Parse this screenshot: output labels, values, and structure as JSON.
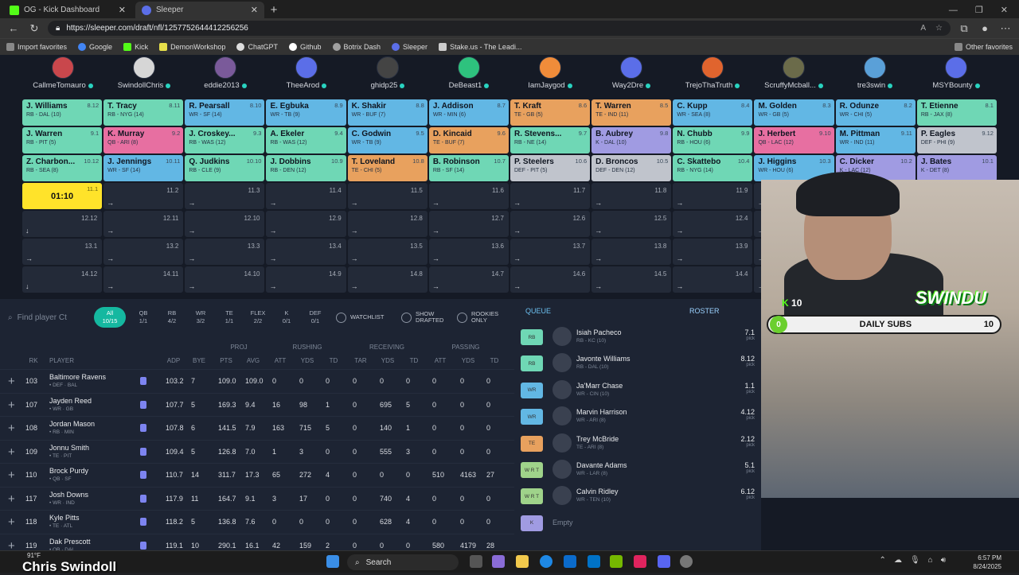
{
  "browser": {
    "tabs": [
      {
        "label": "OG - Kick Dashboard",
        "active": false
      },
      {
        "label": "Sleeper",
        "active": true
      }
    ],
    "url": "https://sleeper.com/draft/nfl/1257752644412256256",
    "bookmarks": [
      "Import favorites",
      "Google",
      "Kick",
      "DemonWorkshop",
      "ChatGPT",
      "Github",
      "Botrix Dash",
      "Sleeper",
      "Stake.us - The Leadi..."
    ],
    "other_favorites": "Other favorites"
  },
  "teams": [
    "CallmeTomauro",
    "SwindollChris",
    "eddie2013",
    "TheeArod",
    "ghidp25",
    "DeBeast1",
    "IamJaygod",
    "Way2Dre",
    "TrejoThaTruth",
    "ScruffyMcball...",
    "tre3swin",
    "MSYBounty"
  ],
  "board": {
    "rows": [
      [
        {
          "name": "J. Williams",
          "pos": "RB - DAL (10)",
          "no": "8.12",
          "cls": "rb"
        },
        {
          "name": "T. Tracy",
          "pos": "RB - NYG (14)",
          "no": "8.11",
          "cls": "rb"
        },
        {
          "name": "R. Pearsall",
          "pos": "WR - SF (14)",
          "no": "8.10",
          "cls": "wr"
        },
        {
          "name": "E. Egbuka",
          "pos": "WR - TB (9)",
          "no": "8.9",
          "cls": "wr"
        },
        {
          "name": "K. Shakir",
          "pos": "WR - BUF (7)",
          "no": "8.8",
          "cls": "wr"
        },
        {
          "name": "J. Addison",
          "pos": "WR - MIN (6)",
          "no": "8.7",
          "cls": "wr"
        },
        {
          "name": "T. Kraft",
          "pos": "TE - GB (5)",
          "no": "8.6",
          "cls": "te"
        },
        {
          "name": "T. Warren",
          "pos": "TE - IND (11)",
          "no": "8.5",
          "cls": "te"
        },
        {
          "name": "C. Kupp",
          "pos": "WR - SEA (8)",
          "no": "8.4",
          "cls": "wr"
        },
        {
          "name": "M. Golden",
          "pos": "WR - GB (5)",
          "no": "8.3",
          "cls": "wr"
        },
        {
          "name": "R. Odunze",
          "pos": "WR - CHI (5)",
          "no": "8.2",
          "cls": "wr"
        },
        {
          "name": "T. Etienne",
          "pos": "RB - JAX (8)",
          "no": "8.1",
          "cls": "rb"
        }
      ],
      [
        {
          "name": "J. Warren",
          "pos": "RB - PIT (5)",
          "no": "9.1",
          "cls": "rb"
        },
        {
          "name": "K. Murray",
          "pos": "QB - ARI (8)",
          "no": "9.2",
          "cls": "qb"
        },
        {
          "name": "J. Croskey...",
          "pos": "RB - WAS (12)",
          "no": "9.3",
          "cls": "rb"
        },
        {
          "name": "A. Ekeler",
          "pos": "RB - WAS (12)",
          "no": "9.4",
          "cls": "rb"
        },
        {
          "name": "C. Godwin",
          "pos": "WR - TB (9)",
          "no": "9.5",
          "cls": "wr"
        },
        {
          "name": "D. Kincaid",
          "pos": "TE - BUF (7)",
          "no": "9.6",
          "cls": "te"
        },
        {
          "name": "R. Stevens...",
          "pos": "RB - NE (14)",
          "no": "9.7",
          "cls": "rb"
        },
        {
          "name": "B. Aubrey",
          "pos": "K - DAL (10)",
          "no": "9.8",
          "cls": "k"
        },
        {
          "name": "N. Chubb",
          "pos": "RB - HOU (6)",
          "no": "9.9",
          "cls": "rb"
        },
        {
          "name": "J. Herbert",
          "pos": "QB - LAC (12)",
          "no": "9.10",
          "cls": "qb"
        },
        {
          "name": "M. Pittman",
          "pos": "WR - IND (11)",
          "no": "9.11",
          "cls": "wr"
        },
        {
          "name": "P. Eagles",
          "pos": "DEF - PHI (9)",
          "no": "9.12",
          "cls": "def"
        }
      ],
      [
        {
          "name": "Z. Charbon...",
          "pos": "RB - SEA (8)",
          "no": "10.12",
          "cls": "rb"
        },
        {
          "name": "J. Jennings",
          "pos": "WR - SF (14)",
          "no": "10.11",
          "cls": "wr"
        },
        {
          "name": "Q. Judkins",
          "pos": "RB - CLE (9)",
          "no": "10.10",
          "cls": "rb"
        },
        {
          "name": "J. Dobbins",
          "pos": "RB - DEN (12)",
          "no": "10.9",
          "cls": "rb"
        },
        {
          "name": "T. Loveland",
          "pos": "TE - CHI (5)",
          "no": "10.8",
          "cls": "te"
        },
        {
          "name": "B. Robinson",
          "pos": "RB - SF (14)",
          "no": "10.7",
          "cls": "rb"
        },
        {
          "name": "P. Steelers",
          "pos": "DEF - PIT (5)",
          "no": "10.6",
          "cls": "def"
        },
        {
          "name": "D. Broncos",
          "pos": "DEF - DEN (12)",
          "no": "10.5",
          "cls": "def"
        },
        {
          "name": "C. Skattebo",
          "pos": "RB - NYG (14)",
          "no": "10.4",
          "cls": "rb"
        },
        {
          "name": "J. Higgins",
          "pos": "WR - HOU (6)",
          "no": "10.3",
          "cls": "wr"
        },
        {
          "name": "C. Dicker",
          "pos": "K - LAC (12)",
          "no": "10.2",
          "cls": "k"
        },
        {
          "name": "J. Bates",
          "pos": "K - DET (8)",
          "no": "10.1",
          "cls": "k"
        }
      ]
    ],
    "clock": "01:10",
    "empty_rows": [
      [
        "11.1",
        "11.2",
        "11.3",
        "11.4",
        "11.5",
        "11.6",
        "11.7",
        "11.8",
        "11.9",
        "11.10",
        "11.11",
        "11.12"
      ],
      [
        "12.12",
        "12.11",
        "12.10",
        "12.9",
        "12.8",
        "12.7",
        "12.6",
        "12.5",
        "12.4",
        "12.3",
        "12.2",
        "12.1"
      ],
      [
        "13.1",
        "13.2",
        "13.3",
        "13.4",
        "13.5",
        "13.6",
        "13.7",
        "13.8",
        "13.9",
        "13.10",
        "13.11",
        "13.12"
      ],
      [
        "14.12",
        "14.11",
        "14.10",
        "14.9",
        "14.8",
        "14.7",
        "14.6",
        "14.5",
        "14.4",
        "14.3",
        "14.2",
        "14.1"
      ]
    ]
  },
  "filters": {
    "search_placeholder": "Find player Ct",
    "positions": [
      {
        "label": "All",
        "count": "10/15",
        "active": true
      },
      {
        "label": "QB",
        "count": "1/1"
      },
      {
        "label": "RB",
        "count": "4/2"
      },
      {
        "label": "WR",
        "count": "3/2"
      },
      {
        "label": "TE",
        "count": "1/1"
      },
      {
        "label": "FLEX",
        "count": "2/2"
      },
      {
        "label": "K",
        "count": "0/1"
      },
      {
        "label": "DEF",
        "count": "0/1"
      }
    ],
    "watchlist": "WATCHLIST",
    "show_drafted": "SHOW DRAFTED",
    "rookies_only": "ROOKIES ONLY"
  },
  "table": {
    "groups": [
      "PROJ",
      "RUSHING",
      "RECEIVING",
      "PASSING"
    ],
    "columns": [
      "RK",
      "PLAYER",
      "ADP",
      "BYE",
      "PTS",
      "AVG",
      "ATT",
      "YDS",
      "TD",
      "TAR",
      "YDS",
      "TD",
      "ATT",
      "YDS",
      "TD"
    ],
    "rows": [
      {
        "rk": "103",
        "name": "Baltimore Ravens",
        "pos": "• DEF · BAL",
        "vals": [
          "103.2",
          "7",
          "109.0",
          "109.0",
          "0",
          "0",
          "0",
          "0",
          "0",
          "0",
          "0",
          "0",
          "0"
        ]
      },
      {
        "rk": "107",
        "name": "Jayden Reed",
        "pos": "• WR · GB",
        "vals": [
          "107.7",
          "5",
          "169.3",
          "9.4",
          "16",
          "98",
          "1",
          "0",
          "695",
          "5",
          "0",
          "0",
          "0"
        ]
      },
      {
        "rk": "108",
        "name": "Jordan Mason",
        "pos": "• RB · MIN",
        "vals": [
          "107.8",
          "6",
          "141.5",
          "7.9",
          "163",
          "715",
          "5",
          "0",
          "140",
          "1",
          "0",
          "0",
          "0"
        ]
      },
      {
        "rk": "109",
        "name": "Jonnu Smith",
        "pos": "• TE · PIT",
        "vals": [
          "109.4",
          "5",
          "126.8",
          "7.0",
          "1",
          "3",
          "0",
          "0",
          "555",
          "3",
          "0",
          "0",
          "0"
        ]
      },
      {
        "rk": "110",
        "name": "Brock Purdy",
        "pos": "• QB · SF",
        "vals": [
          "110.7",
          "14",
          "311.7",
          "17.3",
          "65",
          "272",
          "4",
          "0",
          "0",
          "0",
          "510",
          "4163",
          "27"
        ]
      },
      {
        "rk": "117",
        "name": "Josh Downs",
        "pos": "• WR · IND",
        "vals": [
          "117.9",
          "11",
          "164.7",
          "9.1",
          "3",
          "17",
          "0",
          "0",
          "740",
          "4",
          "0",
          "0",
          "0"
        ]
      },
      {
        "rk": "118",
        "name": "Kyle Pitts",
        "pos": "• TE · ATL",
        "vals": [
          "118.2",
          "5",
          "136.8",
          "7.6",
          "0",
          "0",
          "0",
          "0",
          "628",
          "4",
          "0",
          "0",
          "0"
        ]
      },
      {
        "rk": "119",
        "name": "Dak Prescott",
        "pos": "• QB · DAL",
        "vals": [
          "119.1",
          "10",
          "290.1",
          "16.1",
          "42",
          "159",
          "2",
          "0",
          "0",
          "0",
          "580",
          "4179",
          "28"
        ]
      }
    ]
  },
  "queue": {
    "tab_queue": "QUEUE",
    "tab_roster": "ROSTER",
    "items": [
      {
        "pos": "RB",
        "color": "#6fd7b5",
        "name": "Isiah Pacheco",
        "sub": "RB - KC (10)",
        "val": "7.1",
        "pick": "pick"
      },
      {
        "pos": "RB",
        "color": "#6fd7b5",
        "name": "Javonte Williams",
        "sub": "RB - DAL (10)",
        "val": "8.12",
        "pick": "pick"
      },
      {
        "pos": "WR",
        "color": "#62b7e4",
        "name": "Ja'Marr Chase",
        "sub": "WR - CIN (10)",
        "val": "1.1",
        "pick": "pick"
      },
      {
        "pos": "WR",
        "color": "#62b7e4",
        "name": "Marvin Harrison",
        "sub": "WR - ARI (8)",
        "val": "4.12",
        "pick": "pick"
      },
      {
        "pos": "TE",
        "color": "#e8a15e",
        "name": "Trey McBride",
        "sub": "TE - ARI (8)",
        "val": "2.12",
        "pick": "pick"
      },
      {
        "pos": "W R T",
        "color": "#9fd38a",
        "name": "Davante Adams",
        "sub": "WR - LAR (8)",
        "val": "5.1",
        "pick": "pick"
      },
      {
        "pos": "W R T",
        "color": "#9fd38a",
        "name": "Calvin Ridley",
        "sub": "WR - TEN (10)",
        "val": "6.12",
        "pick": "pick"
      },
      {
        "pos": "K",
        "color": "#a09be2",
        "name": "Empty",
        "sub": "",
        "val": "",
        "pick": ""
      }
    ]
  },
  "overlay": {
    "kick_count": "10",
    "subs_current": "0",
    "subs_label": "DAILY SUBS",
    "subs_goal": "10",
    "brand": "SWINDU",
    "streamer": "Chris Swindoll",
    "weather": "91°F"
  },
  "taskbar": {
    "search": "Search",
    "time": "6:57 PM",
    "date": "8/24/2025"
  }
}
